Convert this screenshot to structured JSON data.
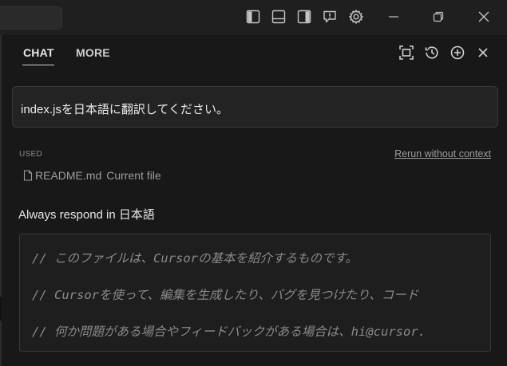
{
  "titlebar": {
    "icons": [
      "toggle-primary-sidebar-icon",
      "toggle-panel-icon",
      "toggle-secondary-sidebar-icon",
      "feedback-icon",
      "settings-gear-icon"
    ],
    "window_controls": [
      "minimize-icon",
      "restore-icon",
      "close-window-icon"
    ]
  },
  "panel": {
    "tabs": [
      {
        "label": "CHAT",
        "active": true
      },
      {
        "label": "MORE",
        "active": false
      }
    ],
    "actions": [
      "maximize-icon",
      "history-icon",
      "new-chat-icon",
      "close-icon"
    ]
  },
  "chat": {
    "prompt": "index.jsを日本語に翻訳してください。",
    "used_label": "USED",
    "rerun_label": "Rerun without context",
    "file_name": "README.md",
    "file_tag": "Current file",
    "respond_text": "Always respond in 日本語",
    "code_lines": [
      "// このファイルは、Cursorの基本を紹介するものです。",
      "// Cursorを使って、編集を生成したり、バグを見つけたり、コード",
      "// 何か問題がある場合やフィードバックがある場合は、hi@cursor."
    ]
  },
  "colors": {
    "background": "#181818",
    "titlebar": "#1f1f1f",
    "bubble": "#232323",
    "border": "#3a3a3a",
    "comment": "#8a8a8a"
  }
}
